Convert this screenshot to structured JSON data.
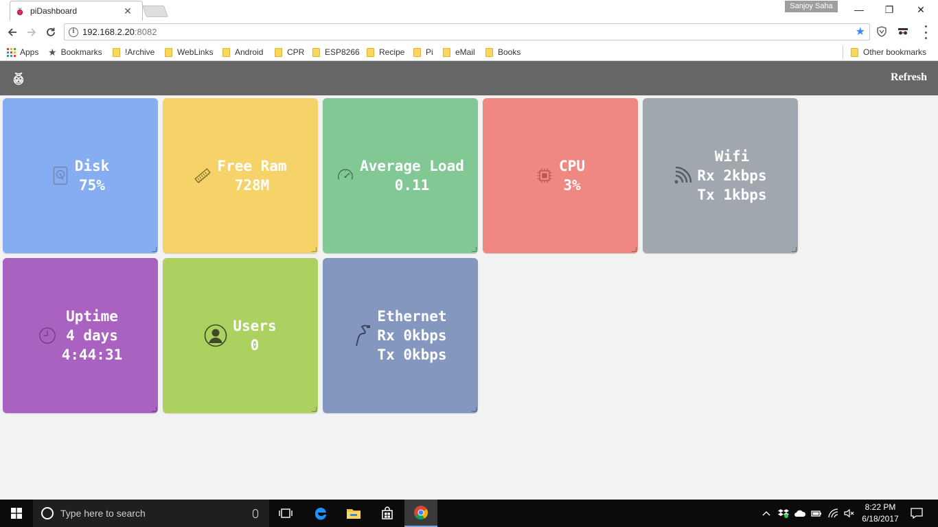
{
  "browser": {
    "tab_title": "piDashboard",
    "tab_close": "✕",
    "profile_name": "Sanjoy Saha",
    "window_controls": {
      "minimize": "—",
      "maximize": "❐",
      "close": "✕"
    },
    "url_host": "192.168.2.20",
    "url_port": ":8082"
  },
  "bookmarks": {
    "apps": "Apps",
    "bookmarks": "Bookmarks",
    "folders": [
      "!Archive",
      "WebLinks",
      "Android",
      "CPR",
      "ESP8266",
      "Recipe",
      "Pi",
      "eMail",
      "Books"
    ],
    "other": "Other bookmarks"
  },
  "app": {
    "refresh_label": "Refresh",
    "header_color": "#666666"
  },
  "tiles": [
    {
      "icon": "hard-disk-icon",
      "color": "#86adf2",
      "lines": [
        "Disk",
        "75%"
      ]
    },
    {
      "icon": "ram-module-icon",
      "color": "#f5d368",
      "lines": [
        "Free Ram",
        "728M"
      ]
    },
    {
      "icon": "speedometer-icon",
      "color": "#82c895",
      "lines": [
        "Average Load",
        "0.11"
      ]
    },
    {
      "icon": "cpu-chip-icon",
      "color": "#ef8880",
      "lines": [
        "CPU",
        "3%"
      ]
    },
    {
      "icon": "wifi-signal-icon",
      "color": "#a0a7ae",
      "lines": [
        "Wifi",
        "Rx 2kbps",
        "Tx 1kbps"
      ]
    },
    {
      "icon": "clock-icon",
      "color": "#a962bf",
      "lines": [
        "Uptime",
        "4 days",
        "4:44:31"
      ]
    },
    {
      "icon": "user-icon",
      "color": "#add161",
      "lines": [
        "Users",
        "0"
      ]
    },
    {
      "icon": "ethernet-cable-icon",
      "color": "#8497bf",
      "lines": [
        "Ethernet",
        "Rx 0kbps",
        "Tx 0kbps"
      ]
    }
  ],
  "taskbar": {
    "search_placeholder": "Type here to search",
    "time": "8:22 PM",
    "date": "6/18/2017"
  }
}
